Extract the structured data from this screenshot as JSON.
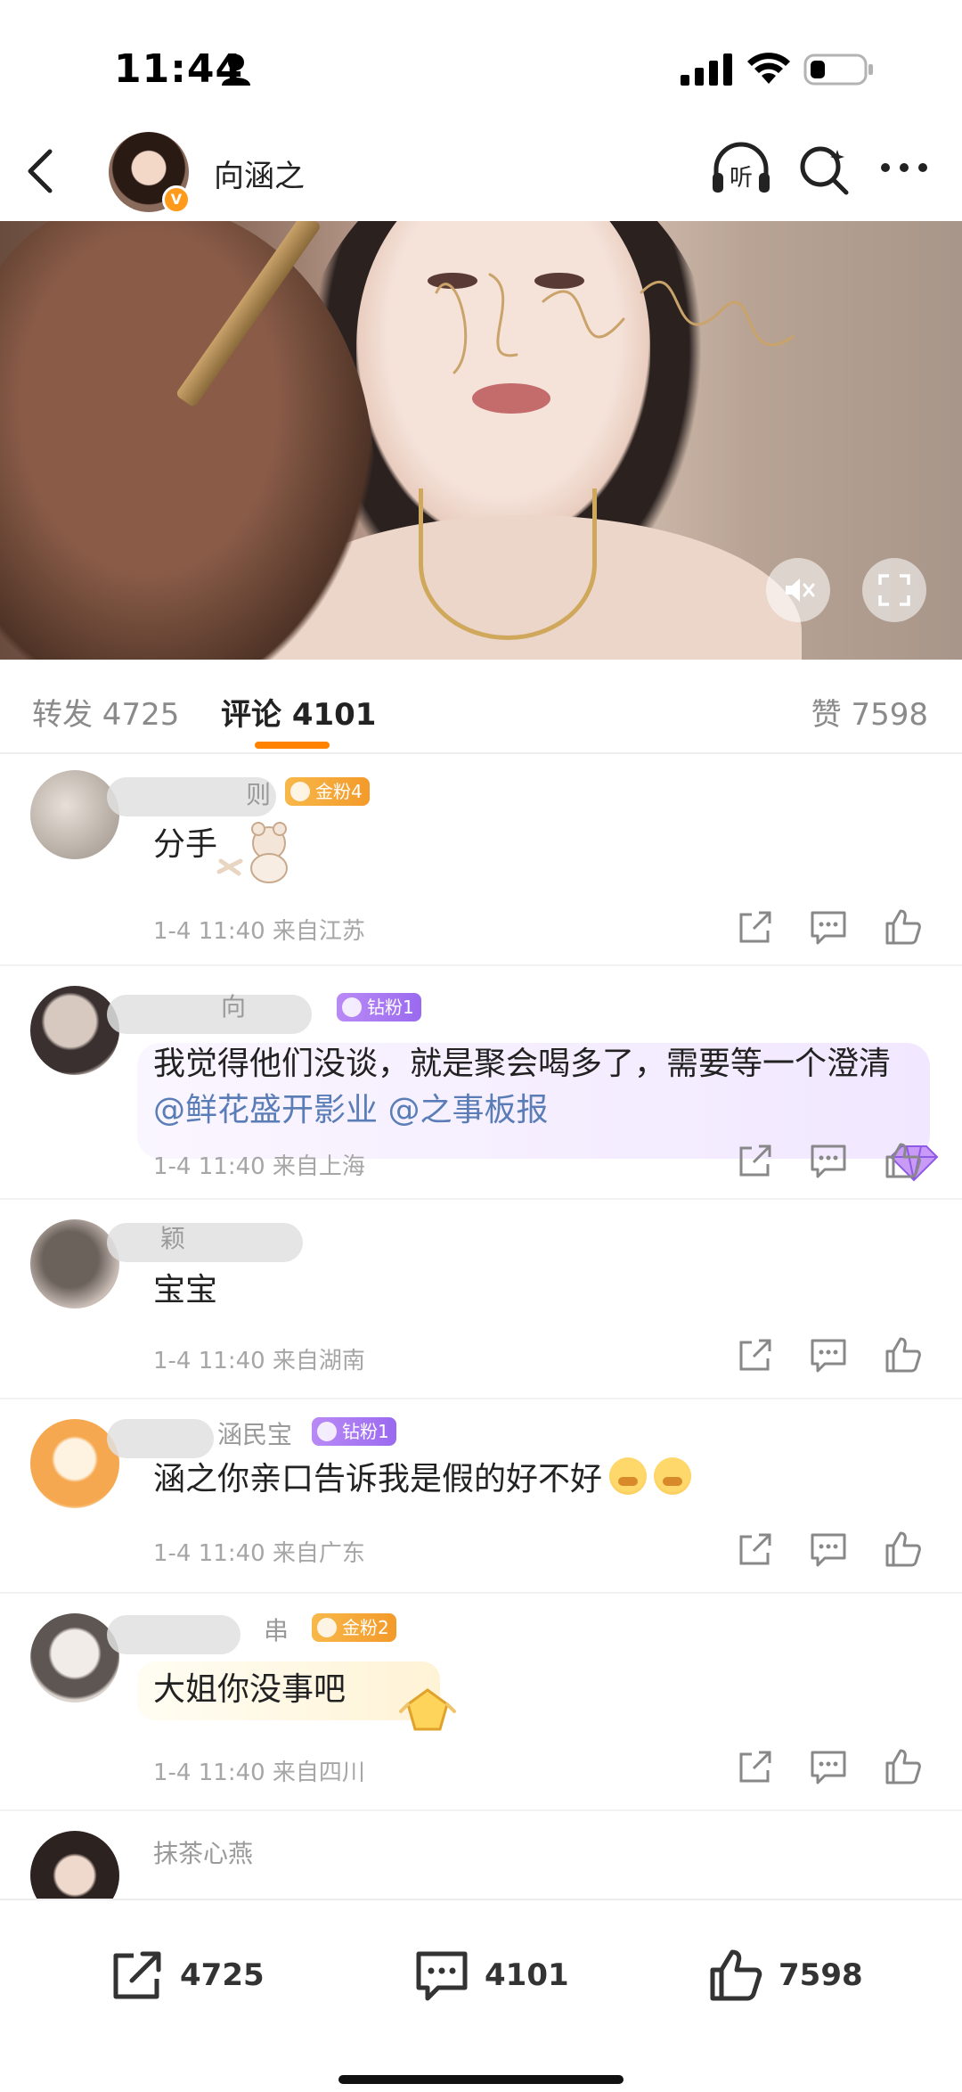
{
  "status_bar": {
    "time": "11:44",
    "icons": [
      "person-icon",
      "signal-icon",
      "wifi-icon",
      "battery-icon"
    ]
  },
  "header": {
    "name": "向涵之",
    "verified_badge": "V",
    "icons": [
      "back-icon",
      "listen-icon",
      "search-icon",
      "more-icon"
    ],
    "listen_label": "听"
  },
  "video": {
    "controls": [
      "mute-icon",
      "fullscreen-icon"
    ]
  },
  "tabs": {
    "repost": "转发 4725",
    "comment": "评论 4101",
    "like": "赞 7598",
    "accent": "#ff8200"
  },
  "comments": [
    {
      "username": "则",
      "badge": "金粉4",
      "text": "分手",
      "meta": "1-4 11:40 来自江苏"
    },
    {
      "username": "向",
      "badge": "钻粉1",
      "text": "我觉得他们没谈，就是聚会喝多了，需要等一个澄清",
      "mention1": "@鲜花盛开影业",
      "mention2": "@之事板报",
      "meta": "1-4 11:40 来自上海"
    },
    {
      "username": "颖",
      "text": "宝宝",
      "meta": "1-4 11:40 来自湖南"
    },
    {
      "username": "涵民宝",
      "badge": "钻粉1",
      "text": "涵之你亲口告诉我是假的好不好",
      "meta": "1-4 11:40 来自广东"
    },
    {
      "username": "串",
      "badge": "金粉2",
      "text": "大姐你没事吧",
      "meta": "1-4 11:40 来自四川"
    },
    {
      "username": "抹茶心燕"
    }
  ],
  "bottom_bar": {
    "repost_count": "4725",
    "comment_count": "4101",
    "like_count": "7598"
  },
  "colors": {
    "mention": "#5a7db7",
    "gold_badge": "#f3a23a",
    "diamond_badge": "#a57af2",
    "meta_gray": "#a6a6a6"
  }
}
